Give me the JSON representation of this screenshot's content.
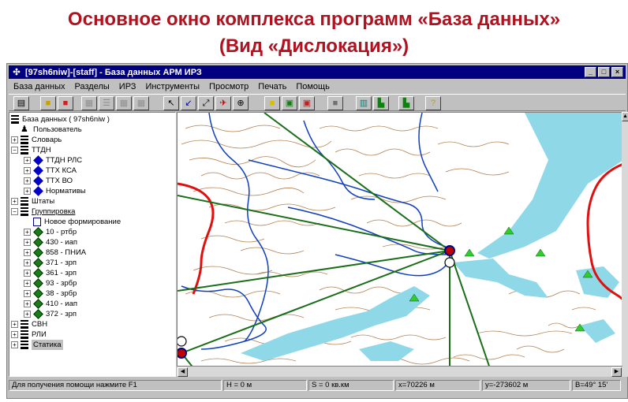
{
  "slide": {
    "title_line1": "Основное окно комплекса программ «База данных»",
    "title_line2": "(Вид «Дислокация»)"
  },
  "window": {
    "title": "[97sh6niw]-[staff] - База данных АРМ ИРЗ",
    "controls": [
      "minimize",
      "maximize",
      "close"
    ]
  },
  "menu": [
    "База данных",
    "Разделы",
    "ИРЗ",
    "Инструменты",
    "Просмотр",
    "Печать",
    "Помощь"
  ],
  "toolbar": {
    "buttons": [
      "open-icon",
      "folder-icon",
      "color-palette-icon",
      "form-icon",
      "list-icon",
      "table-icon",
      "table2-icon",
      "pointer-icon",
      "arrow-diag-icon",
      "arrow-diag2-icon",
      "plane-icon",
      "crosshair-icon",
      "yellow-rect-icon",
      "map-frame-icon",
      "red-frame-icon",
      "gray-square-icon",
      "layers-icon",
      "chart-icon",
      "chart2-icon",
      "help-icon"
    ]
  },
  "tree": {
    "root": "База данных ( 97sh6niw )",
    "user": "Пользователь",
    "slovar": "Словарь",
    "ttdn": "ТТДН",
    "ttdn_rls": "ТТДН РЛС",
    "ttx_ksa": "ТТХ КСА",
    "ttx_vo": "ТТХ ВО",
    "normativy": "Нормативы",
    "shtaty": "Штаты",
    "gruppirovka": "Группировка",
    "new_form": "Новое формирование",
    "units": [
      "10 - ртбр",
      "430 - иап",
      "858 - ПНИА",
      "371 - зрп",
      "361 - зрп",
      "93 - зрбр",
      "38 - зрбр",
      "410 - иап",
      "372 - зрп"
    ],
    "svn": "СВН",
    "rli": "РЛИ",
    "statika": "Статика"
  },
  "status": {
    "help": "Для получения помощи нажмите F1",
    "h": "H = 0 м",
    "s": "S = 0  кв.км",
    "x": "x=70226 м",
    "y": "y=-273602 м",
    "b": "B=49° 15'"
  },
  "colors": {
    "title_red": "#b0121f",
    "titlebar": "#000080",
    "contour": "#b08050",
    "river_blue": "#1040c0",
    "water": "#8fd8e8",
    "boundary_red": "#e01010",
    "lines_green": "#1a6e1a",
    "triangles": "#2ecc2e"
  }
}
